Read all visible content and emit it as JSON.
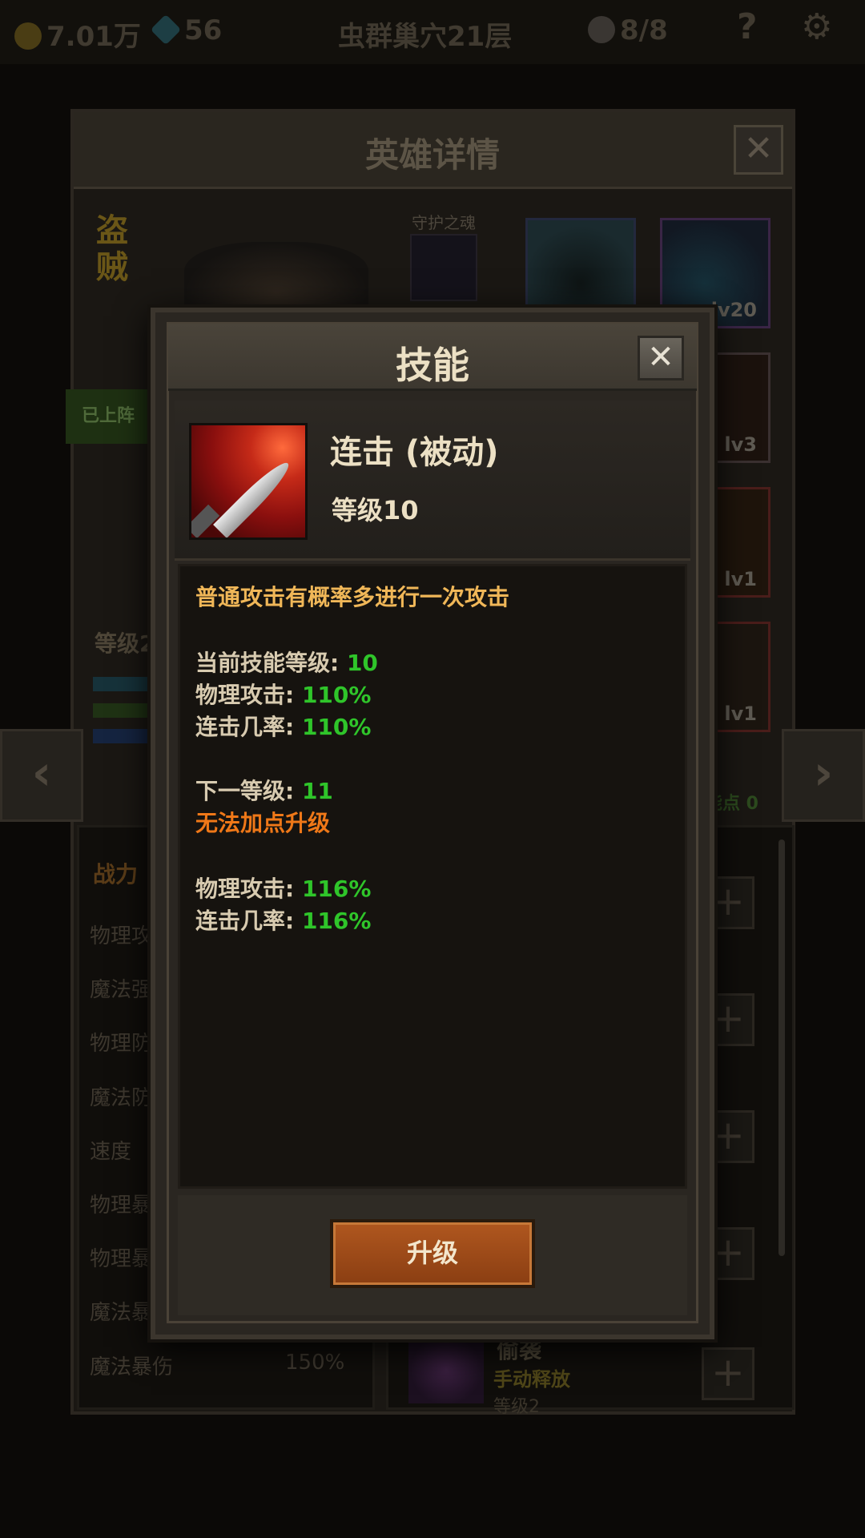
{
  "topbar": {
    "gold": "7.01万",
    "gems": "56",
    "stage": "虫群巢穴21层",
    "keys": "8/8",
    "help_glyph": "?",
    "settings_glyph": "⚙"
  },
  "hero": {
    "title": "英雄详情",
    "class_name": "盗贼",
    "soul_label": "守护之魂",
    "deployed": "已上阵",
    "level_label": "等级2",
    "skill_points": "能点 0",
    "equipment": [
      {
        "level": ""
      },
      {
        "level": "lv20"
      },
      {
        "level": "lv3"
      },
      {
        "level": "lv1"
      },
      {
        "level": "lv1"
      }
    ],
    "stats_title": "战力",
    "stats": [
      "物理攻",
      "魔法强",
      "物理防",
      "魔法防",
      "速度",
      "物理暴",
      "物理暴",
      "魔法暴",
      "魔法暴伤"
    ],
    "last_stat_value": "150%",
    "bottom_skill": {
      "name": "偷袭",
      "type": "手动释放",
      "level": "等级2"
    }
  },
  "modal": {
    "title": "技能",
    "close_glyph": "✕",
    "skill_name": "连击 (被动)",
    "skill_level": "等级10",
    "description": "普通攻击有概率多进行一次攻击",
    "current_level_label": "当前技能等级: ",
    "current_level_value": "10",
    "phys_atk_label": "物理攻击: ",
    "phys_atk_value": "110%",
    "combo_rate_label": "连击几率: ",
    "combo_rate_value": "110%",
    "next_level_label": "下一等级: ",
    "next_level_value": "11",
    "cannot_upgrade": "无法加点升级",
    "next_phys_atk_label": "物理攻击: ",
    "next_phys_atk_value": "116%",
    "next_combo_rate_label": "连击几率: ",
    "next_combo_rate_value": "116%",
    "upgrade_label": "升级"
  },
  "colors": {
    "value_green": "#2fc52a",
    "description_orange": "#f0b758",
    "warning_orange": "#ef7818",
    "button_brown": "#a04b1a"
  },
  "icons": {
    "gold": "gold-coin-icon",
    "gem": "gem-icon",
    "key": "skull-icon",
    "help": "help-icon",
    "settings": "gear-icon",
    "skill": "blade-slash-icon"
  }
}
